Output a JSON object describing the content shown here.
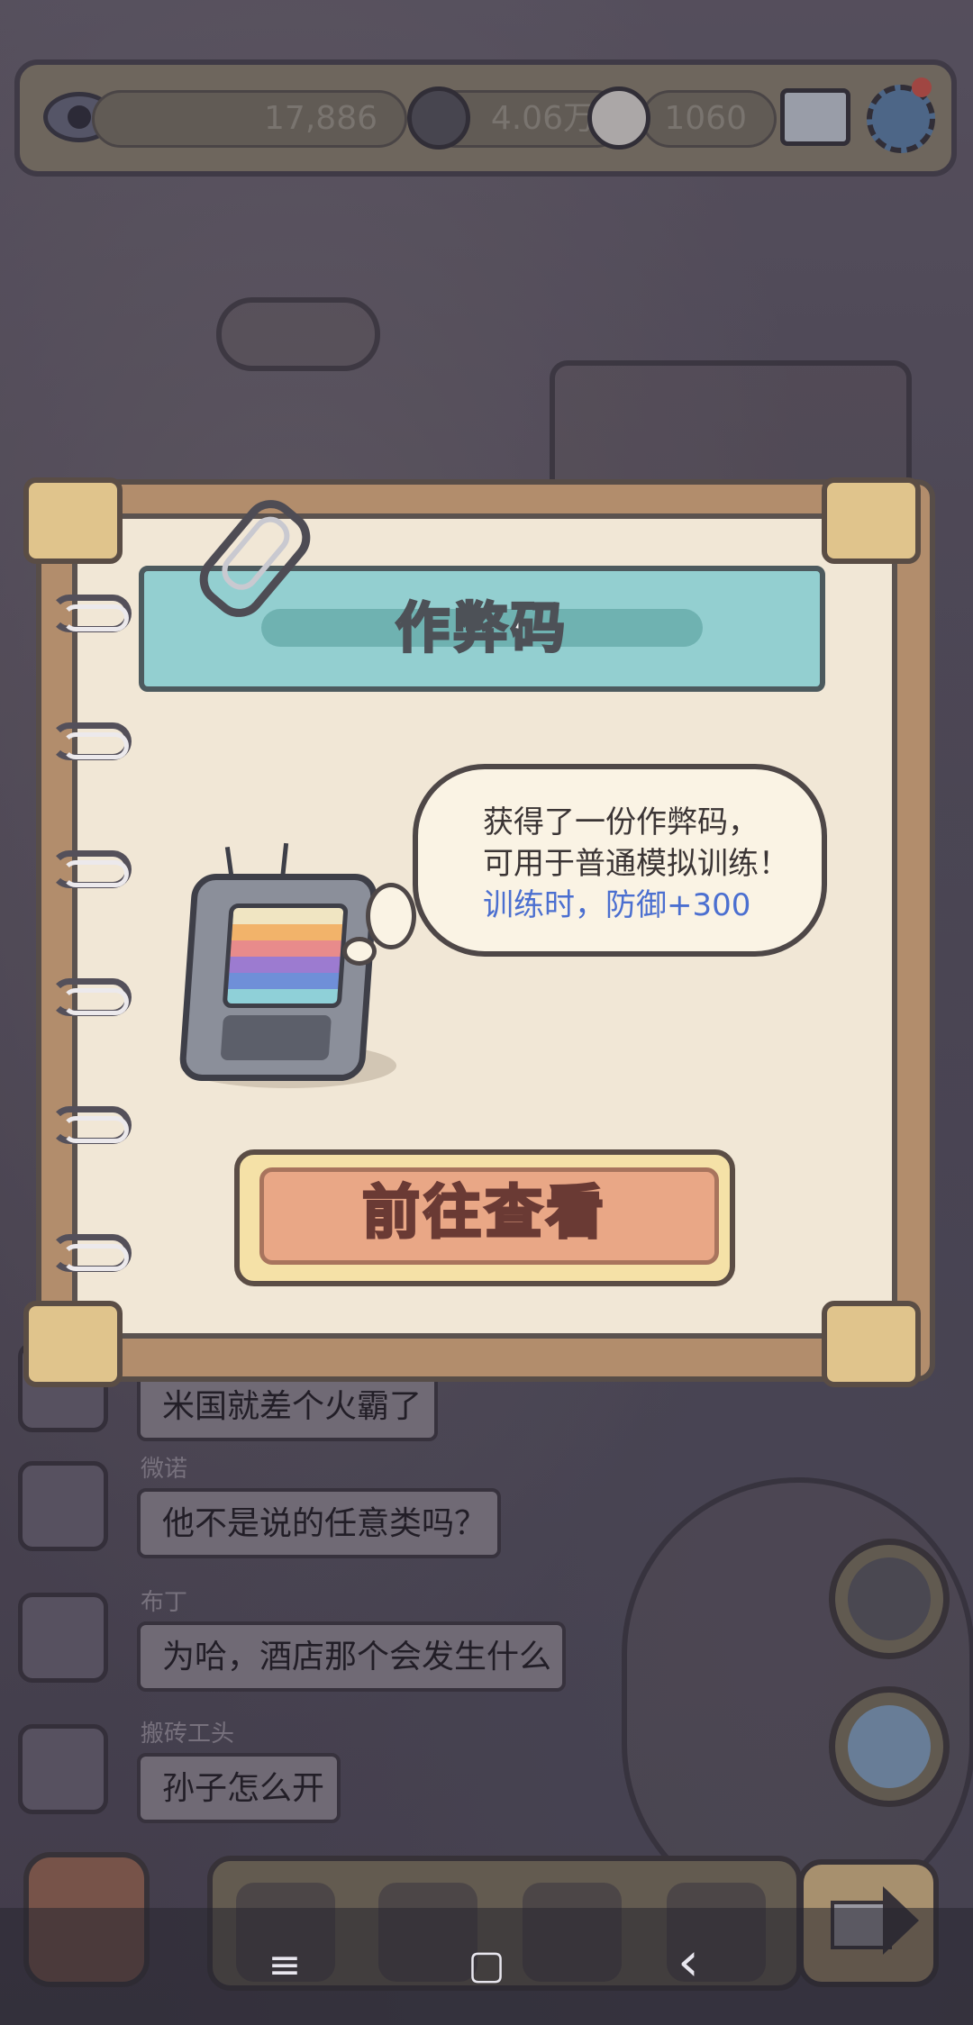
{
  "topbar": {
    "views_value": "17,886",
    "coins_value": "4.06万",
    "messages_value": "1060"
  },
  "dialog": {
    "title": "作弊码",
    "bubble_line1": "获得了一份作弊码，",
    "bubble_line2": "可用于普通模拟训练！",
    "bubble_line3": "训练时，防御+300",
    "button_label": "前往查看"
  },
  "chat": {
    "messages": [
      {
        "name": "",
        "text": "米国就差个火霸了"
      },
      {
        "name": "微诺",
        "text": "他不是说的任意类吗？"
      },
      {
        "name": "布丁",
        "text": "为哈，酒店那个会发生什么"
      },
      {
        "name": "搬砖工头",
        "text": "孙子怎么开"
      }
    ]
  },
  "nav": {
    "menu_icon": "≡",
    "home_icon": "▢",
    "back_icon": "‹"
  },
  "colors": {
    "title_banner": "#93cfd0",
    "action_button": "#e9a786",
    "bubble_highlight": "#4b6fd0"
  }
}
